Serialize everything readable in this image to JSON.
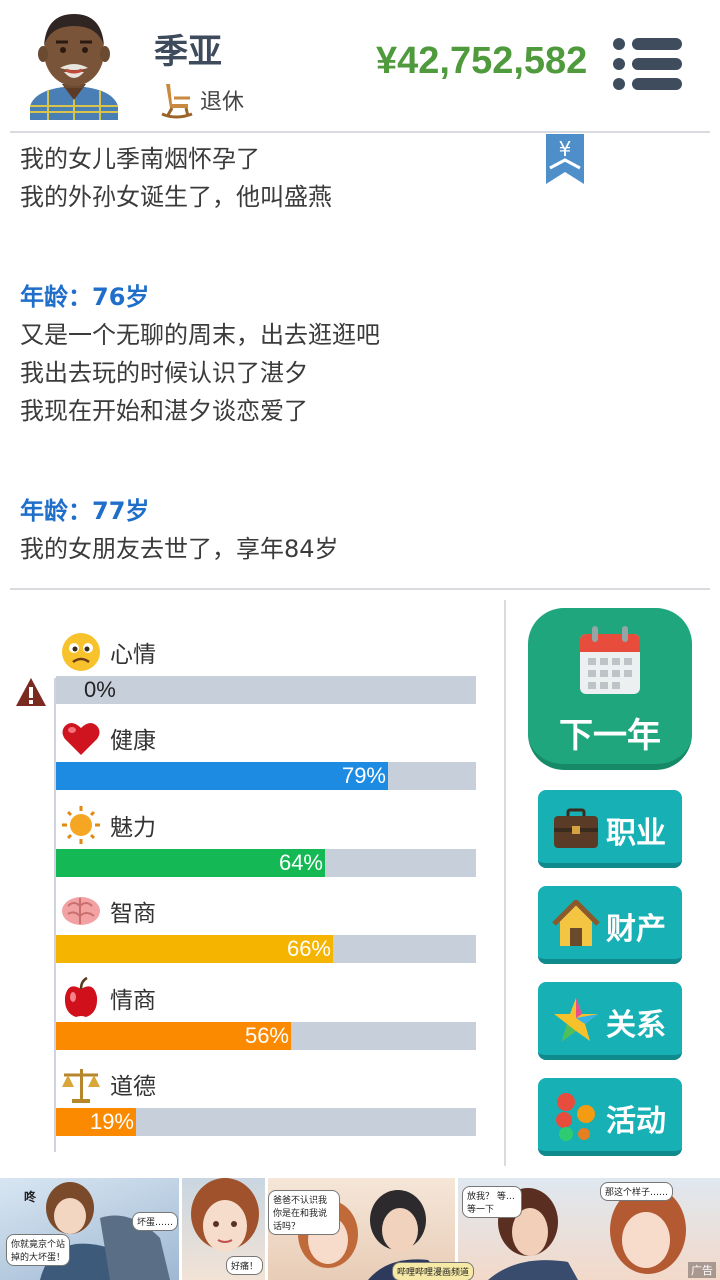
{
  "header": {
    "name": "季亚",
    "status": "退休",
    "money": "¥42,752,582",
    "bookmark_symbol": "¥"
  },
  "log": {
    "lines_top": [
      "我的女儿季南烟怀孕了",
      "我的外孙女诞生了，他叫盛燕"
    ],
    "entries": [
      {
        "age": "年龄：76岁",
        "lines": [
          "又是一个无聊的周末，出去逛逛吧",
          "我出去玩的时候认识了湛夕",
          "我现在开始和湛夕谈恋爱了"
        ]
      },
      {
        "age": "年龄：77岁",
        "lines": [
          "我的女朋友去世了，享年84岁"
        ]
      }
    ]
  },
  "stats": [
    {
      "label": "心情",
      "value": 0,
      "display": "0%",
      "color": "#1e8be2",
      "icon": "sad-face-icon"
    },
    {
      "label": "健康",
      "value": 79,
      "display": "79%",
      "color": "#1e8be2",
      "icon": "heart-icon"
    },
    {
      "label": "魅力",
      "value": 64,
      "display": "64%",
      "color": "#14b955",
      "icon": "sun-icon"
    },
    {
      "label": "智商",
      "value": 66,
      "display": "66%",
      "color": "#f5b400",
      "icon": "brain-icon"
    },
    {
      "label": "情商",
      "value": 56,
      "display": "56%",
      "color": "#fb8a00",
      "icon": "apple-icon"
    },
    {
      "label": "道德",
      "value": 19,
      "display": "19%",
      "color": "#fb8a00",
      "icon": "scale-icon"
    }
  ],
  "buttons": {
    "next_year": "下一年",
    "career": "职业",
    "property": "财产",
    "relations": "关系",
    "activities": "活动"
  },
  "ad": {
    "bubbles": [
      "咚",
      "你就竟京个站 掉的大坏蛋！",
      "坏蛋……",
      "好痛！",
      "爸爸不认识我 你是在和我说 话吗？",
      "哔哩哔哩漫画频道",
      "放我？ 等…等一下",
      "那这个样子……"
    ],
    "tag": "广告"
  }
}
